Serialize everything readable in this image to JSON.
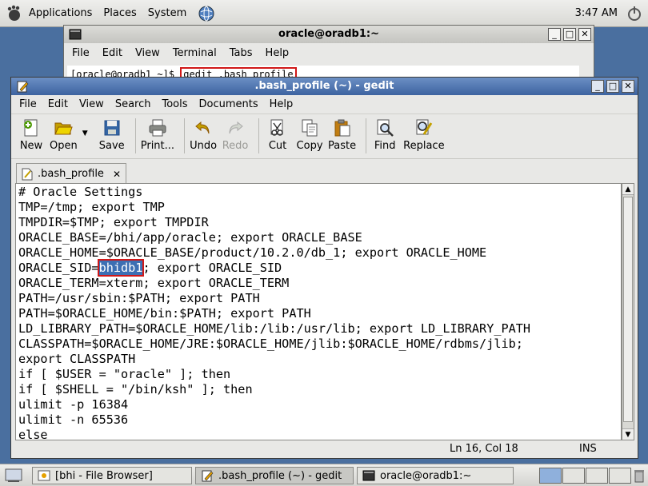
{
  "top_panel": {
    "menus": [
      "Applications",
      "Places",
      "System"
    ],
    "clock": "3:47 AM"
  },
  "terminal": {
    "title": "oracle@oradb1:~",
    "menus": [
      "File",
      "Edit",
      "View",
      "Terminal",
      "Tabs",
      "Help"
    ],
    "prompt": "[oracle@oradb1 ~]$ ",
    "command": "gedit .bash_profile"
  },
  "gedit": {
    "title": ".bash_profile (~) - gedit",
    "menus": [
      "File",
      "Edit",
      "View",
      "Search",
      "Tools",
      "Documents",
      "Help"
    ],
    "toolbar": {
      "new": "New",
      "open": "Open",
      "save": "Save",
      "print": "Print...",
      "undo": "Undo",
      "redo": "Redo",
      "cut": "Cut",
      "copy": "Copy",
      "paste": "Paste",
      "find": "Find",
      "replace": "Replace"
    },
    "tab_label": ".bash_profile",
    "lines": [
      "# Oracle Settings",
      "TMP=/tmp; export TMP",
      "TMPDIR=$TMP; export TMPDIR",
      "ORACLE_BASE=/bhi/app/oracle; export ORACLE_BASE",
      "ORACLE_HOME=$ORACLE_BASE/product/10.2.0/db_1; export ORACLE_HOME"
    ],
    "sid_line": {
      "prefix": "ORACLE_SID=",
      "selected": "bhidb1",
      "suffix": "; export ORACLE_SID"
    },
    "lines_after": [
      "ORACLE_TERM=xterm; export ORACLE_TERM",
      "PATH=/usr/sbin:$PATH; export PATH",
      "PATH=$ORACLE_HOME/bin:$PATH; export PATH",
      "LD_LIBRARY_PATH=$ORACLE_HOME/lib:/lib:/usr/lib; export LD_LIBRARY_PATH",
      "CLASSPATH=$ORACLE_HOME/JRE:$ORACLE_HOME/jlib:$ORACLE_HOME/rdbms/jlib;",
      "export CLASSPATH",
      "if [ $USER = \"oracle\" ]; then",
      "if [ $SHELL = \"/bin/ksh\" ]; then",
      "ulimit -p 16384",
      "ulimit -n 65536",
      "else"
    ],
    "status": {
      "position": "Ln 16, Col 18",
      "mode": "INS"
    }
  },
  "taskbar": {
    "tasks": [
      "[bhi - File Browser]",
      ".bash_profile (~) - gedit",
      "oracle@oradb1:~"
    ]
  }
}
